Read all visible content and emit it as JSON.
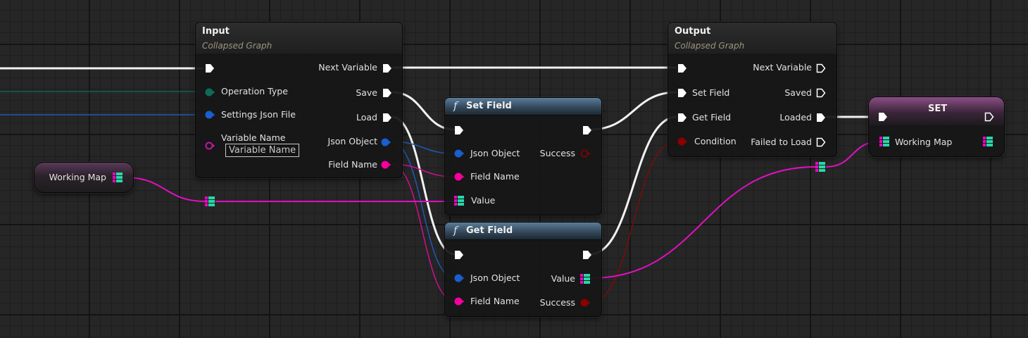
{
  "input_node": {
    "title": "Input",
    "subtitle": "Collapsed Graph",
    "inputs": {
      "operation_type": "Operation Type",
      "settings_json_file": "Settings Json File",
      "variable_name": "Variable Name",
      "variable_name_placeholder": "Variable Name"
    },
    "outputs": {
      "next_variable": "Next Variable",
      "save": "Save",
      "load": "Load",
      "json_object": "Json Object",
      "field_name": "Field Name"
    }
  },
  "set_field_node": {
    "title": "Set Field",
    "function_symbol": "f",
    "inputs": {
      "json_object": "Json Object",
      "field_name": "Field Name",
      "value": "Value"
    },
    "outputs": {
      "success": "Success"
    }
  },
  "get_field_node": {
    "title": "Get Field",
    "function_symbol": "f",
    "inputs": {
      "json_object": "Json Object",
      "field_name": "Field Name"
    },
    "outputs": {
      "value": "Value",
      "success": "Success"
    }
  },
  "output_node": {
    "title": "Output",
    "subtitle": "Collapsed Graph",
    "inputs": {
      "set_field": "Set Field",
      "get_field": "Get Field",
      "condition": "Condition"
    },
    "outputs": {
      "next_variable": "Next Variable",
      "saved": "Saved",
      "loaded": "Loaded",
      "failed_to_load": "Failed to Load"
    }
  },
  "set_node": {
    "title": "SET",
    "inputs": {
      "working_map": "Working Map"
    }
  },
  "working_map_node": {
    "label": "Working Map"
  },
  "pin_colors": {
    "exec": "#ffffff",
    "map": "#f300c8",
    "map_value": "#27d8a8",
    "json_object": "#1a5ecf",
    "string": "#f5009e",
    "boolean": "#8b0000",
    "enum": "#0d6b5a",
    "name": "#c017a0"
  }
}
